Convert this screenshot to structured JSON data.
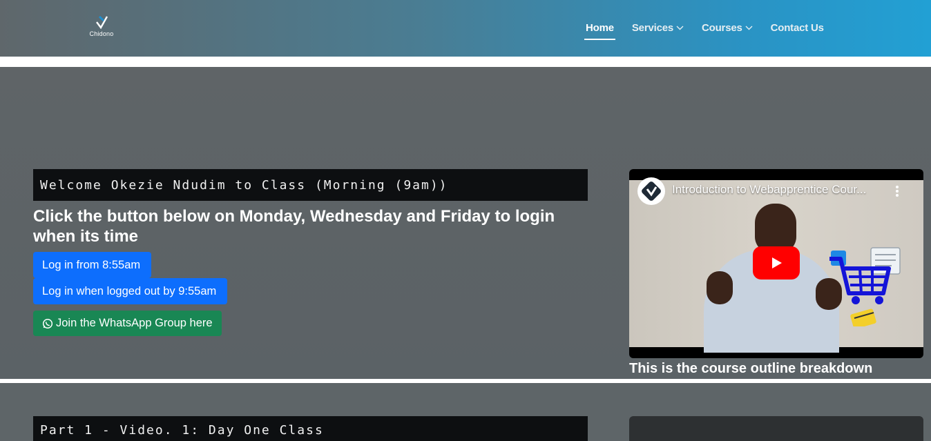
{
  "header": {
    "logo_text": "Chidono",
    "nav": [
      {
        "label": "Home",
        "active": true
      },
      {
        "label": "Services",
        "dropdown": true
      },
      {
        "label": "Courses",
        "dropdown": true
      },
      {
        "label": "Contact Us"
      }
    ]
  },
  "class_section": {
    "welcome_title": "Welcome Okezie Ndudim to Class (Morning (9am))",
    "instructions": "Click the button below on Monday, Wednesday and Friday to login when its time",
    "login_button": "Log in from 8:55am",
    "logout_button": "Log in when logged out by 9:55am",
    "whatsapp_button": "Join the WhatsApp Group here",
    "video": {
      "title": "Introduction to Webapprentice Cour...",
      "caption": "This is the course outline breakdown"
    }
  },
  "part_section": {
    "title": "Part 1 - Video. 1: Day One Class"
  },
  "colors": {
    "primary_button": "#0d6efd",
    "success_button": "#198754",
    "title_bar": "#0d0f11",
    "youtube_red": "#ff0000"
  },
  "icons": [
    "logo-mark-icon",
    "chevron-down-icon",
    "whatsapp-icon",
    "play-icon",
    "more-vertical-icon",
    "channel-logo-icon",
    "shopping-cart-icon"
  ]
}
